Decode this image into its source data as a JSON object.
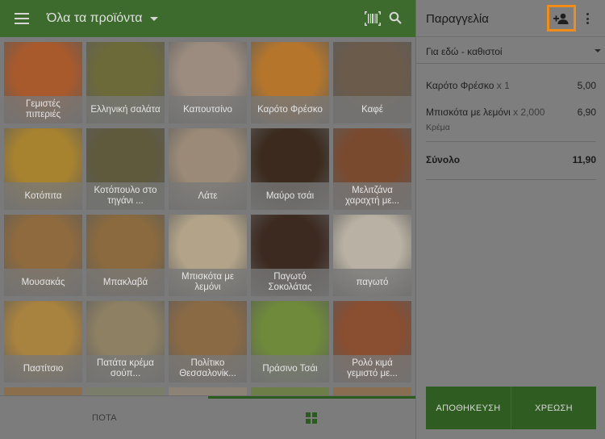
{
  "app": {
    "accent": "#3d6a2d",
    "highlight": "#f08c1a"
  },
  "topbar": {
    "menu_icon": "hamburger-icon",
    "title": "Όλα τα προϊόντα",
    "barcode_icon": "barcode-icon",
    "search_icon": "search-icon"
  },
  "products": [
    {
      "label": "Γεμιστές πιπεριές",
      "color": "#a85a2c"
    },
    {
      "label": "Ελληνική σαλάτα",
      "color": "#6d6a3a"
    },
    {
      "label": "Καπουτσίνο",
      "color": "#9b8c7f"
    },
    {
      "label": "Καρότο Φρέσκο",
      "color": "#b5762c"
    },
    {
      "label": "Καφέ",
      "color": "#6b5b4b"
    },
    {
      "label": "Κοτόπιτα",
      "color": "#a8832f"
    },
    {
      "label": "Κοτόπουλο στο τηγάνι ...",
      "color": "#5f5a3c"
    },
    {
      "label": "Λάτε",
      "color": "#9a8a77"
    },
    {
      "label": "Μαύρο τσάι",
      "color": "#3b2a1d"
    },
    {
      "label": "Μελιτζάνα χαραχτή με...",
      "color": "#7a4a2f"
    },
    {
      "label": "Μουσακάς",
      "color": "#8e6a3e"
    },
    {
      "label": "Μπακλαβά",
      "color": "#8a6a3e"
    },
    {
      "label": "Μπισκότα με λεμόνι",
      "color": "#b3a489"
    },
    {
      "label": "Παγωτό Σοκολάτας",
      "color": "#3c2a20"
    },
    {
      "label": "παγωτό",
      "color": "#b9b1a3"
    },
    {
      "label": "Παστίτσιο",
      "color": "#a8823f"
    },
    {
      "label": "Πατάτα κρέμα σούπ...",
      "color": "#8d8063"
    },
    {
      "label": "Πολίτικο Θεσσαλονίκ...",
      "color": "#8a6a45"
    },
    {
      "label": "Πράσινο Τσάι",
      "color": "#6e8a3a"
    },
    {
      "label": "Ρολό κιμά γεμιστό με...",
      "color": "#8a4e31"
    }
  ],
  "bottombar": {
    "drinks_label": "ΠΟΤΑ",
    "grid_icon": "grid-icon"
  },
  "order": {
    "title": "Παραγγελία",
    "add_customer_icon": "add-person-icon",
    "more_icon": "more-vertical-icon",
    "dining_option": "Για εδώ - καθιστοί",
    "lines": [
      {
        "name": "Καρότο Φρέσκο",
        "qty": "x 1",
        "price": "5,00",
        "note": ""
      },
      {
        "name": "Μπισκότα με λεμόνι",
        "qty": "x 2,000",
        "price": "6,90",
        "note": "Κρέμα"
      }
    ],
    "total_label": "Σύνολο",
    "total_value": "11,90",
    "save_label": "ΑΠΟΘΗΚΕΥΣΗ",
    "charge_label": "ΧΡΕΩΣΗ"
  }
}
